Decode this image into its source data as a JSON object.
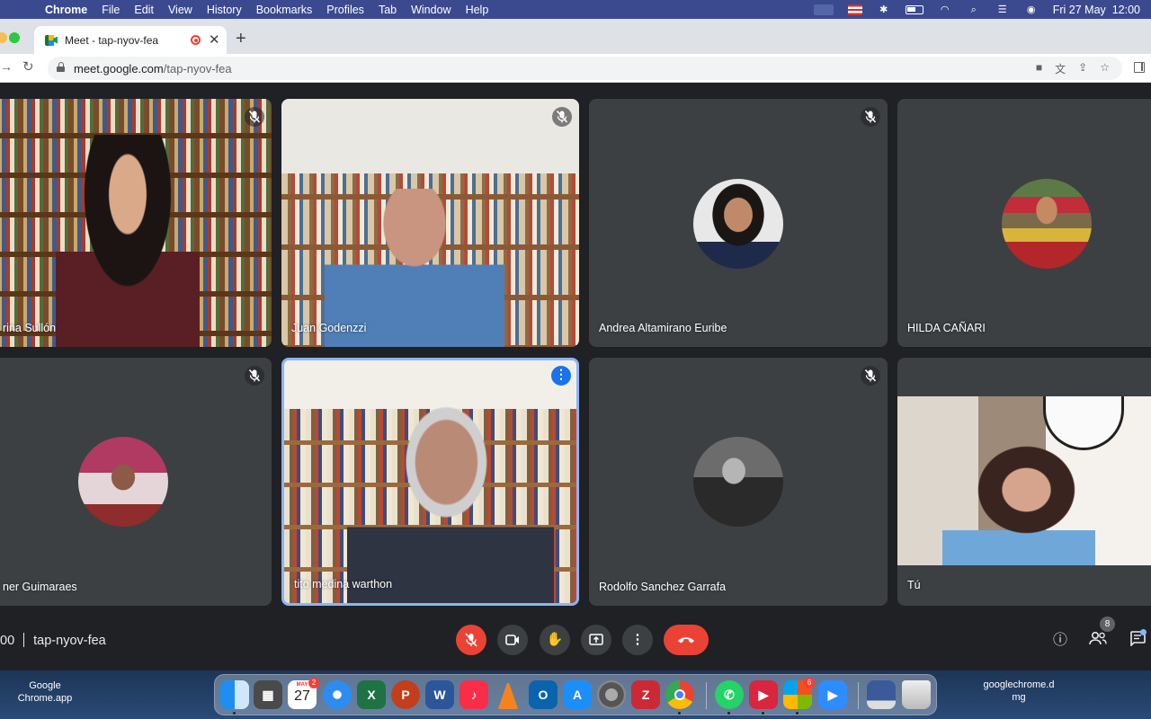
{
  "menubar": {
    "app": "Chrome",
    "items": [
      "File",
      "Edit",
      "View",
      "History",
      "Bookmarks",
      "Profiles",
      "Tab",
      "Window",
      "Help"
    ],
    "clock": "Fri 27 May  12:00"
  },
  "browser": {
    "tab_title": "Meet - tap-nyov-fea",
    "url_host": "meet.google.com",
    "url_path": "/tap-nyov-fea",
    "new_tab": "+",
    "close_tab": "✕"
  },
  "participants": [
    {
      "name": "rina Sullón",
      "muted": true
    },
    {
      "name": "Juan Godenzzi",
      "muted": true
    },
    {
      "name": "Andrea Altamirano Euribe",
      "muted": true
    },
    {
      "name": "HILDA CAÑARI",
      "muted": false
    },
    {
      "name": "ner Guimaraes",
      "muted": true
    },
    {
      "name": "tito medina warthon",
      "muted": false,
      "active": true
    },
    {
      "name": "Rodolfo Sanchez Garrafa",
      "muted": true
    },
    {
      "name": "Tú",
      "muted": false
    }
  ],
  "controls": {
    "time": "00",
    "meeting_code": "tap-nyov-fea",
    "more_glyph": "⋮",
    "participants_count": "8"
  },
  "desktop": {
    "left_label": "Google Chrome.app",
    "right_label": "googlechrome.d mg"
  },
  "dock": {
    "calendar_month": "MAY",
    "calendar_day": "27",
    "calendar_badge": "2",
    "apps_badge": "6",
    "icons": [
      "finder-icon",
      "calculator-icon",
      "calendar-icon",
      "safari-icon",
      "excel-icon",
      "powerpoint-icon",
      "word-icon",
      "music-icon",
      "vlc-icon",
      "outlook-icon",
      "app-store-icon",
      "system-preferences-icon",
      "zotero-icon",
      "chrome-icon",
      "whatsapp-icon",
      "pdf-app-icon",
      "microsoft-apps-icon",
      "zoom-icon",
      "screen-icon",
      "trash-icon"
    ]
  },
  "colors": {
    "meet_bg": "#202124",
    "tile_bg": "#3c4043",
    "end_call": "#ea4335",
    "active_border": "#8ab4f8",
    "menubar": "#3b4a8f"
  }
}
